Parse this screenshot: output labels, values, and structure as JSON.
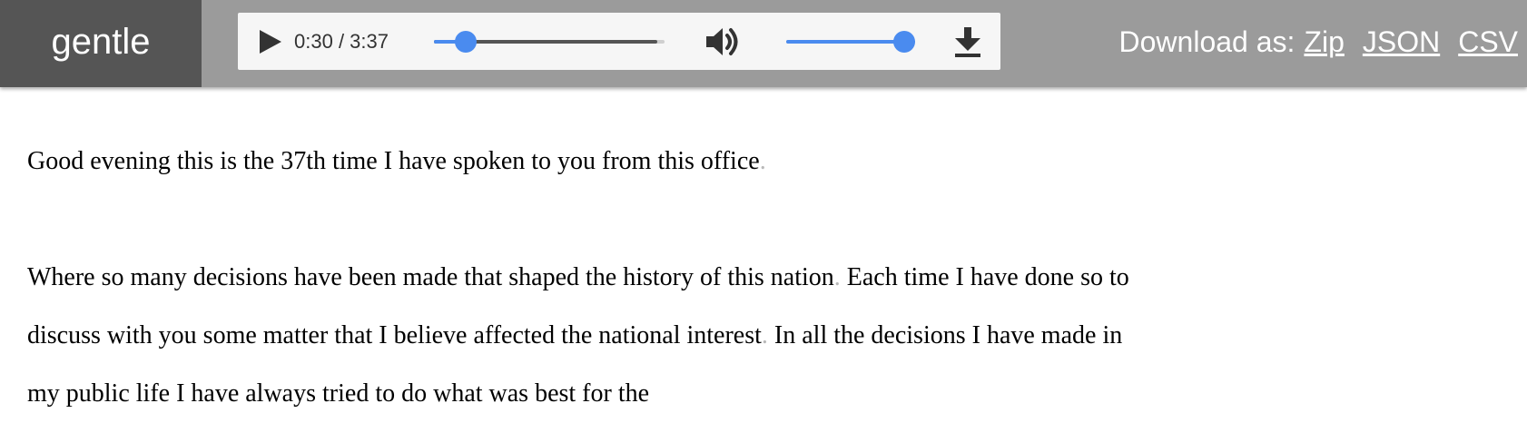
{
  "app": {
    "brand": "gentle"
  },
  "player": {
    "current_time": "0:30",
    "separator": " / ",
    "duration": "3:37",
    "seek_fraction": 0.138,
    "volume_fraction": 1.0,
    "icons": {
      "play": "play-icon",
      "volume": "speaker-icon",
      "download": "download-icon"
    }
  },
  "download": {
    "label": "Download as:",
    "links": [
      "Zip",
      "JSON",
      "CSV"
    ]
  },
  "transcript": {
    "paragraphs": [
      [
        "Good evening this is the 37th time I have spoken to you from this office"
      ],
      [
        "Where so many decisions have been made that shaped the history of this nation",
        " Each time I have done so to discuss with you some matter that I believe affected the national interest",
        " In all the decisions I have made in my public life I have always tried to do what was best for the"
      ]
    ],
    "sentence_end": "."
  },
  "colors": {
    "topbar": "#9b9b9b",
    "brand_bg": "#555555",
    "accent": "#4a8bef",
    "punctuation": "#b9b9b9"
  }
}
